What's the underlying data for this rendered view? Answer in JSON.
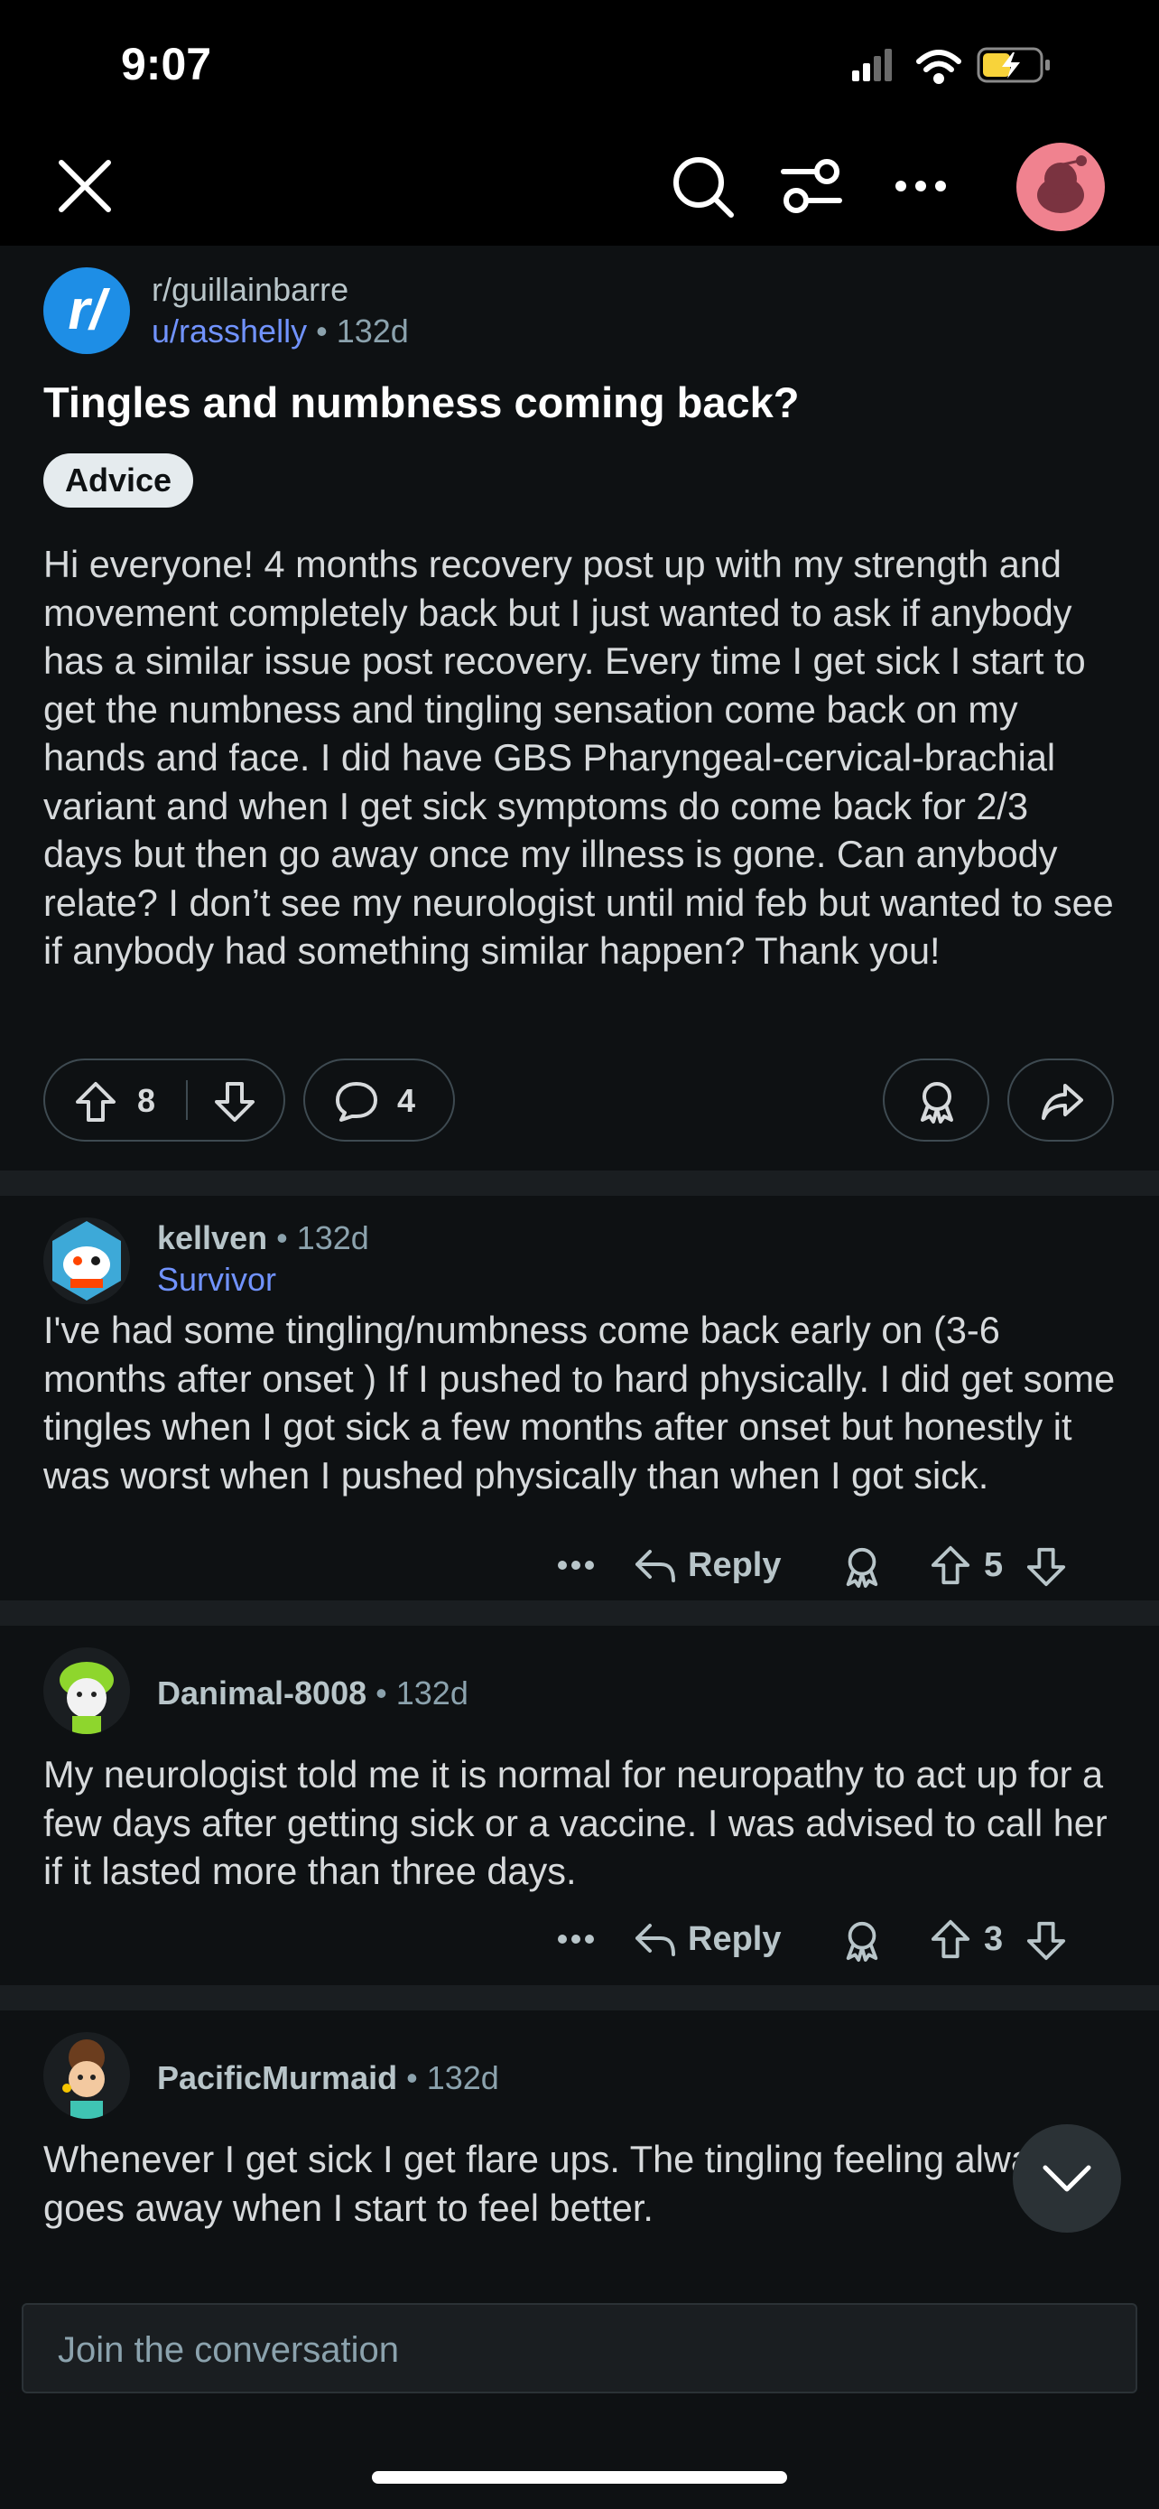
{
  "status_bar": {
    "time": "9:07"
  },
  "top_bar": {
    "close": "close-icon",
    "search": "search-icon",
    "filter": "sort-filter-icon",
    "more": "more-icon",
    "avatar": "profile-avatar"
  },
  "post": {
    "subreddit": "r/guillainbarre",
    "author": "u/rasshelly",
    "separator": "•",
    "age": "132d",
    "title": "Tingles and numbness coming back?",
    "flair": "Advice",
    "body": "Hi everyone! 4 months recovery post up with my strength and movement completely back but I just wanted to ask if anybody has a similar issue post recovery. Every time I get sick I start to get the numbness and tingling sensation come back on my hands and face. I did have GBS Pharyngeal-cervical-brachial variant and when I get sick symptoms do come back for 2/3 days but then go away once my illness is gone. Can anybody relate? I don’t see my neurologist until mid feb but wanted to see if anybody had something similar happen? Thank you!",
    "votes": "8",
    "comments": "4"
  },
  "comments": [
    {
      "author": "kellven",
      "age": "132d",
      "flair": "Survivor",
      "text": "I've had some tingling/numbness come back early on (3-6 months after onset ) If I pushed to hard physically. I did get some tingles when I got sick a few months after onset but honestly it was worst when I pushed physically than when I got sick.",
      "reply_label": "Reply",
      "votes": "5"
    },
    {
      "author": "Danimal-8008",
      "age": "132d",
      "text": "My neurologist told me it is normal for neuropathy to act up for a few days after getting sick or a vaccine. I was advised to call her if it lasted more than three days.",
      "reply_label": "Reply",
      "votes": "3"
    },
    {
      "author": "PacificMurmaid",
      "age": "132d",
      "text": "Whenever I get sick I get flare ups. The tingling feeling always goes away when I start to feel better."
    }
  ],
  "compose": {
    "placeholder": "Join the conversation"
  },
  "colors": {
    "background": "#0e1113",
    "accent_user": "#7193ff",
    "subreddit_icon": "#1e8ee6",
    "battery": "#f8d33a"
  }
}
